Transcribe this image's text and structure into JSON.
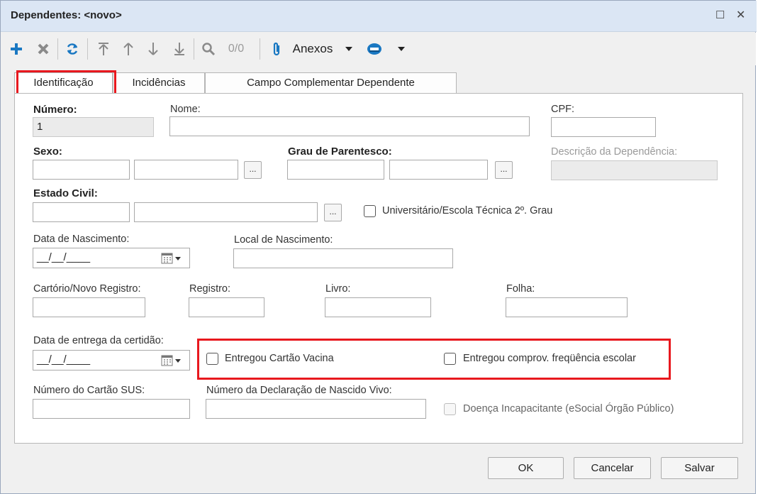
{
  "window": {
    "title": "Dependentes: <novo>",
    "maximize_glyph": "☐",
    "close_glyph": "✕"
  },
  "toolbar": {
    "add_icon": "plus-icon",
    "delete_icon": "delete-icon",
    "refresh_icon": "refresh-icon",
    "first_icon": "first-record-icon",
    "prev_icon": "previous-record-icon",
    "next_icon": "next-record-icon",
    "last_icon": "last-record-icon",
    "search_icon": "search-icon",
    "counter": "0/0",
    "attachments_label": "Anexos",
    "accent_color": "#1a78c2"
  },
  "tabs": [
    {
      "label": "Identificação",
      "active": true
    },
    {
      "label": "Incidências",
      "active": false
    },
    {
      "label": "Campo Complementar Dependente",
      "active": false
    }
  ],
  "form": {
    "numero_label": "Número:",
    "numero_value": "1",
    "nome_label": "Nome:",
    "nome_value": "",
    "cpf_label": "CPF:",
    "cpf_value": "",
    "sexo_label": "Sexo:",
    "grau_label": "Grau de Parentesco:",
    "descricao_label": "Descrição da Dependência:",
    "lookup_button": "...",
    "estado_civil_label": "Estado Civil:",
    "universitario_label": "Universitário/Escola Técnica 2º. Grau",
    "universitario_checked": false,
    "data_nasc_label": "Data de Nascimento:",
    "data_nasc_value": "__/__/____",
    "local_nasc_label": "Local de Nascimento:",
    "cartorio_label": "Cartório/Novo Registro:",
    "registro_label": "Registro:",
    "livro_label": "Livro:",
    "folha_label": "Folha:",
    "data_entrega_label": "Data de entrega da certidão:",
    "data_entrega_value": "__/__/____",
    "cartao_vacina_label": "Entregou Cartão Vacina",
    "cartao_vacina_checked": false,
    "freq_escolar_label": "Entregou comprov. freqüência escolar",
    "freq_escolar_checked": false,
    "cartao_sus_label": "Número do Cartão SUS:",
    "declaracao_label": "Número da Declaração de Nascido Vivo:",
    "doenca_label": "Doença Incapacitante (eSocial Órgão Público)",
    "doenca_checked": false,
    "doenca_enabled": false
  },
  "footer": {
    "ok_label": "OK",
    "cancel_label": "Cancelar",
    "save_label": "Salvar"
  },
  "highlight_color": "#e8181e"
}
